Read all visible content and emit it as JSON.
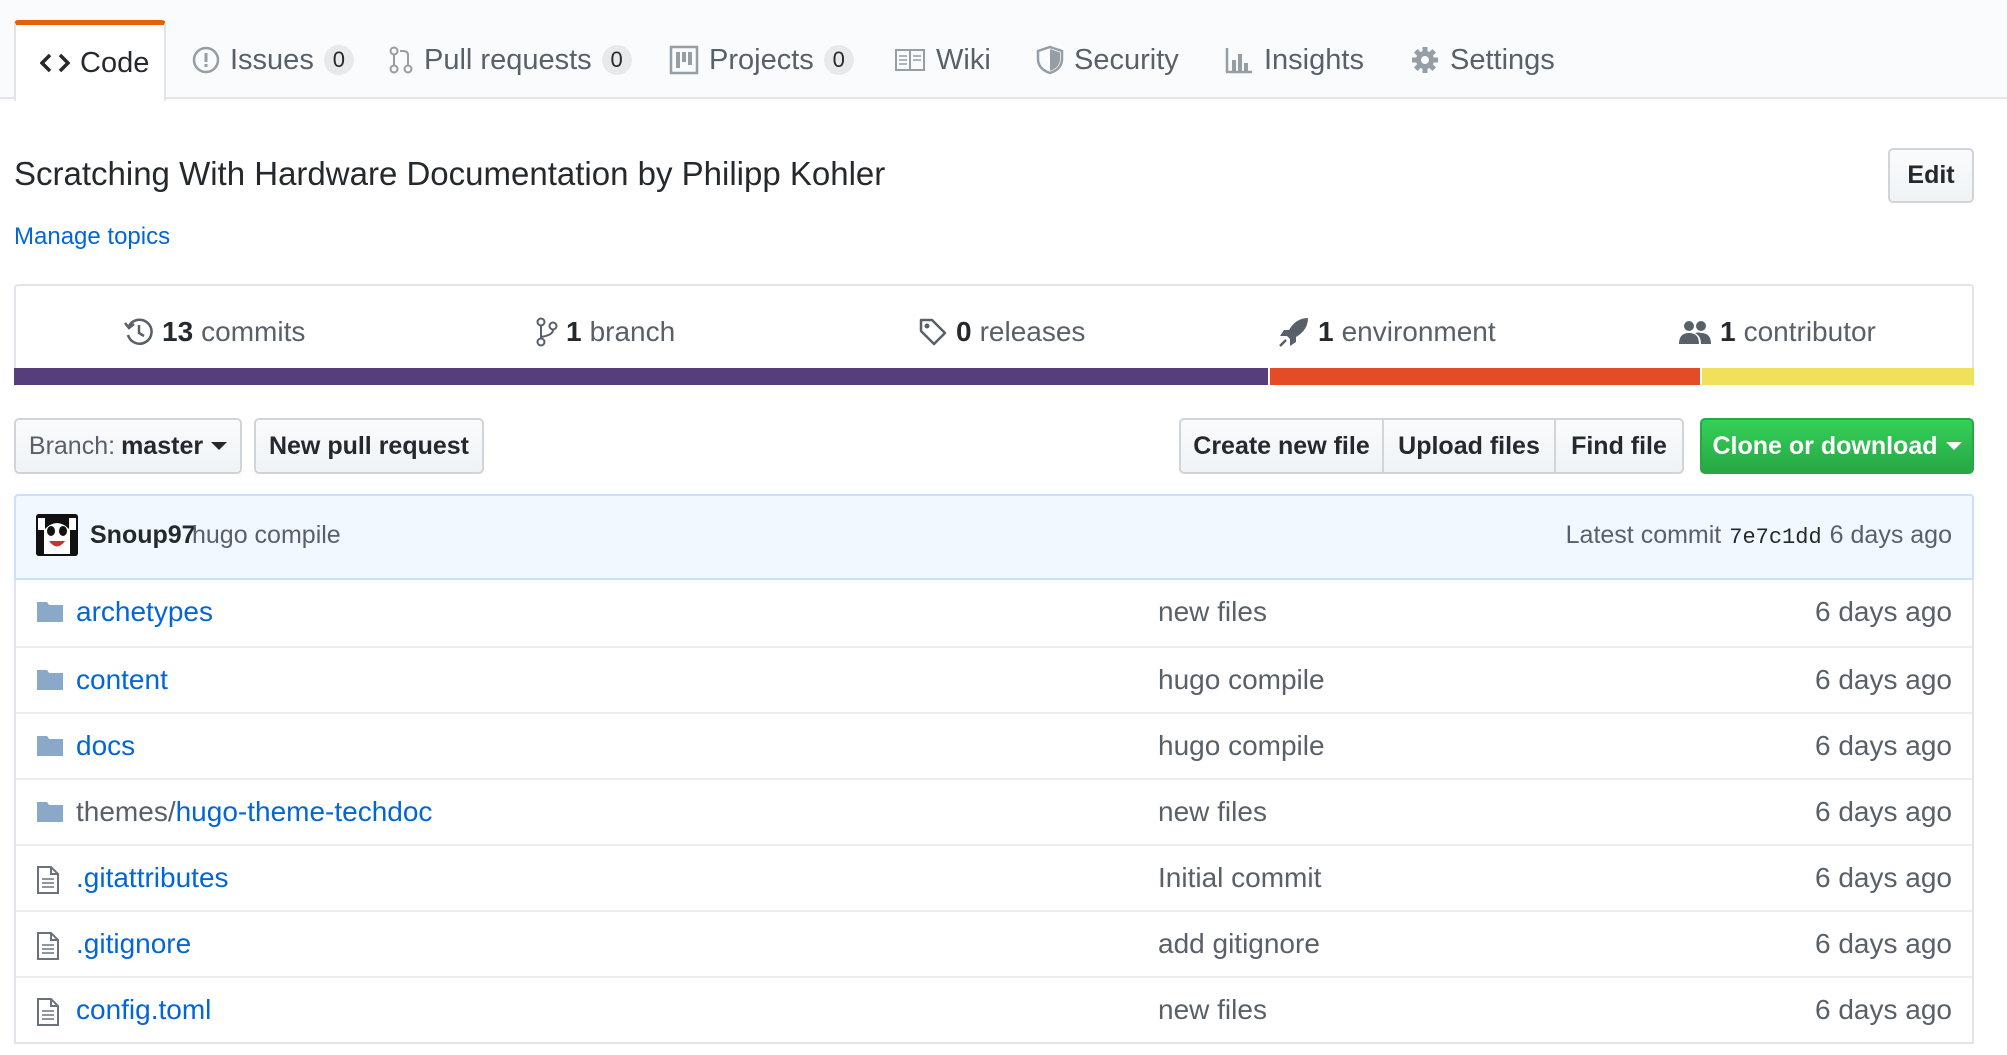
{
  "tabs": [
    {
      "label": "Code",
      "icon": "code-icon",
      "selected": true
    },
    {
      "label": "Issues",
      "icon": "issue-opened-icon",
      "count": "0"
    },
    {
      "label": "Pull requests",
      "icon": "git-pull-request-icon",
      "count": "0"
    },
    {
      "label": "Projects",
      "icon": "project-icon",
      "count": "0"
    },
    {
      "label": "Wiki",
      "icon": "book-icon"
    },
    {
      "label": "Security",
      "icon": "shield-icon"
    },
    {
      "label": "Insights",
      "icon": "graph-icon"
    },
    {
      "label": "Settings",
      "icon": "gear-icon"
    }
  ],
  "repo": {
    "description": "Scratching With Hardware Documentation by Philipp Kohler",
    "manage_topics": "Manage topics",
    "edit_label": "Edit"
  },
  "summary": [
    {
      "num": "13",
      "label": "commits",
      "icon": "history-icon"
    },
    {
      "num": "1",
      "label": "branch",
      "icon": "git-branch-icon"
    },
    {
      "num": "0",
      "label": "releases",
      "icon": "tag-icon"
    },
    {
      "num": "1",
      "label": "environment",
      "icon": "rocket-icon"
    },
    {
      "num": "1",
      "label": "contributor",
      "icon": "organization-icon"
    }
  ],
  "language_bar": [
    {
      "fraction": 0.64,
      "color": "#563d7c"
    },
    {
      "fraction": 0.22,
      "color": "#e34c26"
    },
    {
      "fraction": 0.14,
      "color": "#f1e05a"
    }
  ],
  "file_nav": {
    "branch_prefix": "Branch:",
    "branch_name": "master",
    "new_pull_request": "New pull request",
    "create_new_file": "Create new file",
    "upload_files": "Upload files",
    "find_file": "Find file",
    "clone_or_download": "Clone or download"
  },
  "latest_commit": {
    "author": "Snoup97",
    "message": "hugo compile",
    "prefix": "Latest commit",
    "sha": "7e7c1dd",
    "age": "6 days ago"
  },
  "files": [
    {
      "type": "folder",
      "dir_prefix": "",
      "name": "archetypes",
      "message": "new files",
      "age": "6 days ago"
    },
    {
      "type": "folder",
      "dir_prefix": "",
      "name": "content",
      "message": "hugo compile",
      "age": "6 days ago"
    },
    {
      "type": "folder",
      "dir_prefix": "",
      "name": "docs",
      "message": "hugo compile",
      "age": "6 days ago"
    },
    {
      "type": "folder",
      "dir_prefix": "themes/",
      "name": "hugo-theme-techdoc",
      "message": "new files",
      "age": "6 days ago"
    },
    {
      "type": "file",
      "dir_prefix": "",
      "name": ".gitattributes",
      "message": "Initial commit",
      "age": "6 days ago"
    },
    {
      "type": "file",
      "dir_prefix": "",
      "name": ".gitignore",
      "message": "add gitignore",
      "age": "6 days ago"
    },
    {
      "type": "file",
      "dir_prefix": "",
      "name": "config.toml",
      "message": "new files",
      "age": "6 days ago"
    }
  ]
}
